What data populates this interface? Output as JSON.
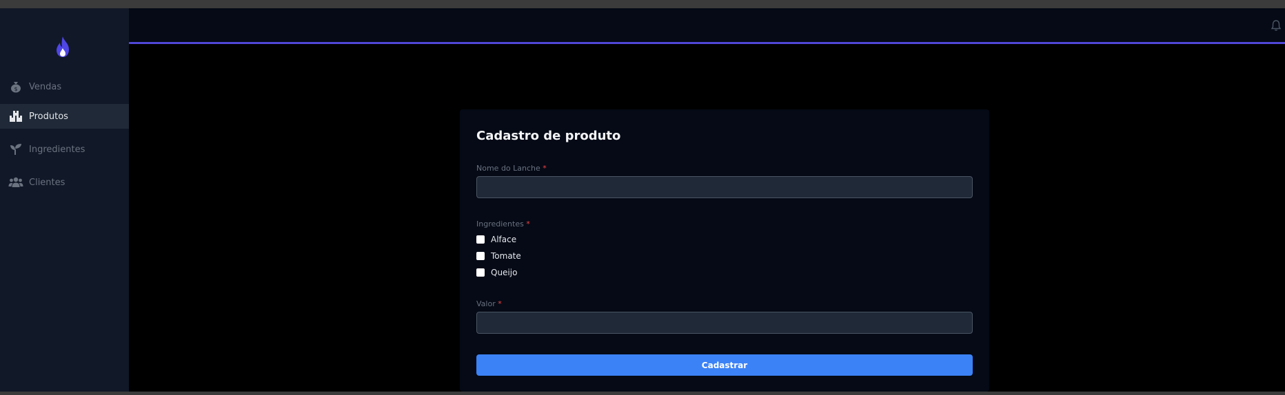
{
  "sidebar": {
    "items": [
      {
        "label": "Vendas",
        "icon": "money-bag-icon"
      },
      {
        "label": "Produtos",
        "icon": "boxes-icon"
      },
      {
        "label": "Ingredientes",
        "icon": "seedling-icon"
      },
      {
        "label": "Clientes",
        "icon": "users-icon"
      }
    ],
    "active_index": 1
  },
  "form": {
    "title": "Cadastro de produto",
    "name_label": "Nome do Lanche",
    "name_value": "",
    "ingredients_label": "Ingredientes",
    "ingredients": [
      "Alface",
      "Tomate",
      "Queijo"
    ],
    "value_label": "Valor",
    "value_value": "",
    "required_mark": "*",
    "submit_label": "Cadastrar"
  },
  "colors": {
    "accent": "#5147d8",
    "button": "#3b82f6",
    "sidebar_bg": "#111827",
    "required": "#ef4444"
  }
}
